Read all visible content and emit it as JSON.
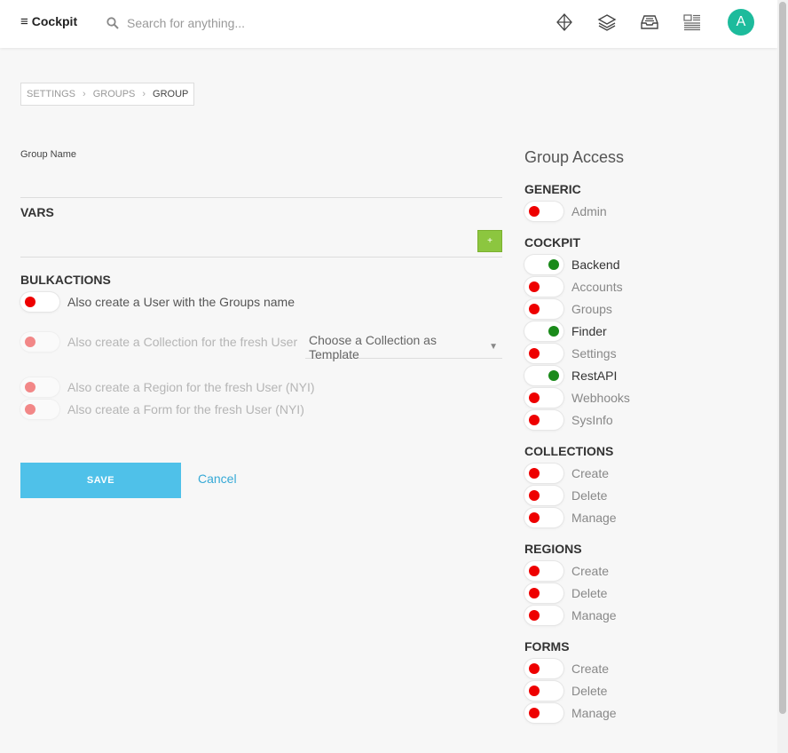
{
  "app": {
    "title": "Cockpit"
  },
  "search": {
    "placeholder": "Search for anything..."
  },
  "topbar_icons": [
    "diamond-icon",
    "layers-icon",
    "inbox-icon",
    "layout-icon"
  ],
  "user": {
    "avatar_initial": "A",
    "avatar_color": "#1dbb9c"
  },
  "breadcrumb": [
    "Settings",
    "Groups",
    "Group"
  ],
  "form": {
    "group_name_label": "Group Name",
    "group_name_value": "",
    "vars_title": "VARS",
    "add_label": "+",
    "bulkactions_title": "BULKACTIONS",
    "options": [
      {
        "label": "Also create a User with the Groups name",
        "enabled": true,
        "checked": false
      },
      {
        "label": "Also create a Collection for the fresh User",
        "enabled": false,
        "checked": false
      },
      {
        "label": "Also create a Region for the fresh User (NYI)",
        "enabled": false,
        "checked": false
      },
      {
        "label": "Also create a Form for the fresh User (NYI)",
        "enabled": false,
        "checked": false
      }
    ],
    "collection_select": "Choose a Collection as Template",
    "save_label": "SAVE",
    "cancel_label": "Cancel"
  },
  "access": {
    "title": "Group Access",
    "categories": [
      {
        "name": "GENERIC",
        "perms": [
          {
            "label": "Admin",
            "on": false
          }
        ]
      },
      {
        "name": "COCKPIT",
        "perms": [
          {
            "label": "Backend",
            "on": true
          },
          {
            "label": "Accounts",
            "on": false
          },
          {
            "label": "Groups",
            "on": false
          },
          {
            "label": "Finder",
            "on": true
          },
          {
            "label": "Settings",
            "on": false
          },
          {
            "label": "RestAPI",
            "on": true
          },
          {
            "label": "Webhooks",
            "on": false
          },
          {
            "label": "SysInfo",
            "on": false
          }
        ]
      },
      {
        "name": "COLLECTIONS",
        "perms": [
          {
            "label": "Create",
            "on": false
          },
          {
            "label": "Delete",
            "on": false
          },
          {
            "label": "Manage",
            "on": false
          }
        ]
      },
      {
        "name": "REGIONS",
        "perms": [
          {
            "label": "Create",
            "on": false
          },
          {
            "label": "Delete",
            "on": false
          },
          {
            "label": "Manage",
            "on": false
          }
        ]
      },
      {
        "name": "FORMS",
        "perms": [
          {
            "label": "Create",
            "on": false
          },
          {
            "label": "Delete",
            "on": false
          },
          {
            "label": "Manage",
            "on": false
          }
        ]
      }
    ]
  },
  "colors": {
    "toggle_off": "#e00000",
    "toggle_on": "#1a8a1a",
    "save": "#4fc1e9",
    "add": "#8cc63f",
    "link": "#36a9d6"
  }
}
